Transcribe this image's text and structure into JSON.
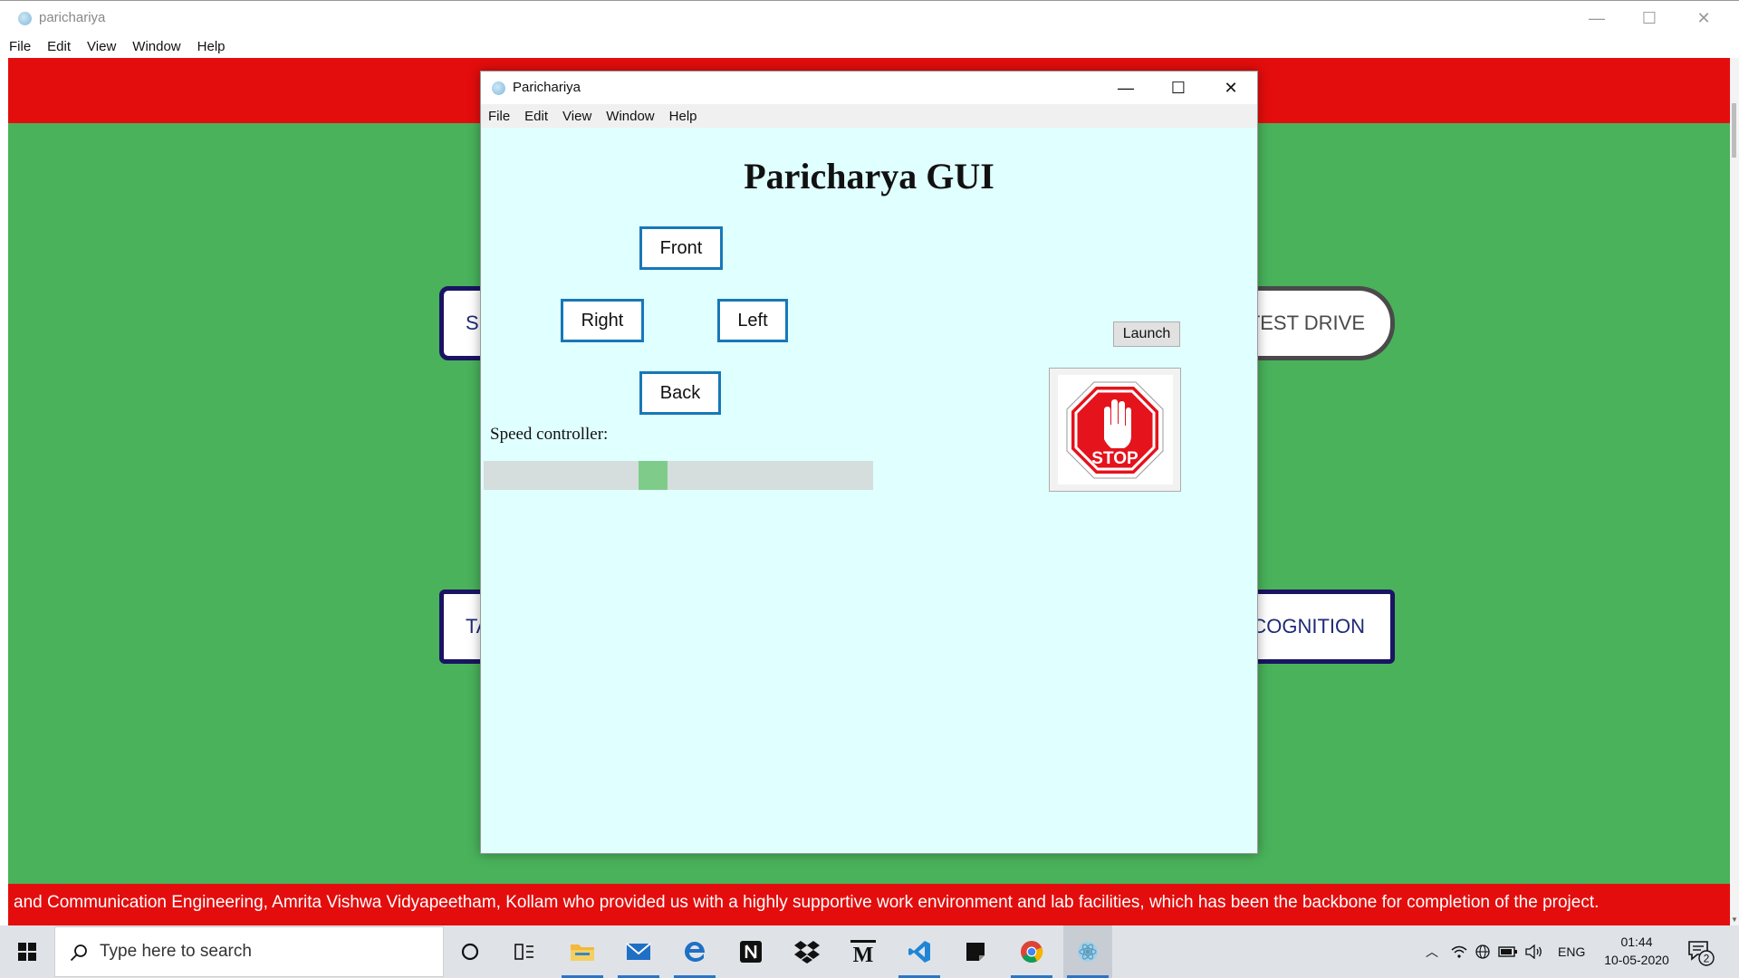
{
  "outer_window": {
    "title": "parichariya",
    "menu": [
      "File",
      "Edit",
      "View",
      "Window",
      "Help"
    ],
    "controls": {
      "minimize": "—",
      "maximize": "☐",
      "close": "✕"
    },
    "background_buttons": [
      "SI",
      "TEST DRIVE",
      "TA",
      "COGNITION"
    ],
    "marquee_text": "and Communication Engineering, Amrita Vishwa Vidyapeetham, Kollam who provided us with a highly supportive work environment and lab facilities, which has been the backbone for completion of the project.",
    "colors": {
      "green": "#49b25b",
      "red": "#e40d0d",
      "navy": "#1a1463"
    }
  },
  "dialog": {
    "title": "Parichariya",
    "menu": [
      "File",
      "Edit",
      "View",
      "Window",
      "Help"
    ],
    "controls": {
      "minimize": "—",
      "maximize": "☐",
      "close": "✕"
    },
    "heading": "Paricharya GUI",
    "buttons": {
      "front": "Front",
      "right": "Right",
      "left": "Left",
      "back": "Back",
      "launch": "Launch"
    },
    "speed": {
      "label": "Speed controller:",
      "value_fraction": 0.43
    },
    "stop_image_text": "STOP",
    "colors": {
      "background": "#e0ffff",
      "button_border": "#1678b8",
      "slider_thumb": "#7fcc8a"
    }
  },
  "taskbar": {
    "search_placeholder": "Type here to search",
    "apps": [
      "task-view",
      "file-explorer",
      "mail",
      "edge",
      "notion",
      "dropbox",
      "m-app",
      "vscode",
      "sticky-notes",
      "chrome",
      "parichariya-app"
    ],
    "tray": {
      "language": "ENG",
      "time": "01:44",
      "date": "10-05-2020",
      "notification_count": "2"
    }
  }
}
